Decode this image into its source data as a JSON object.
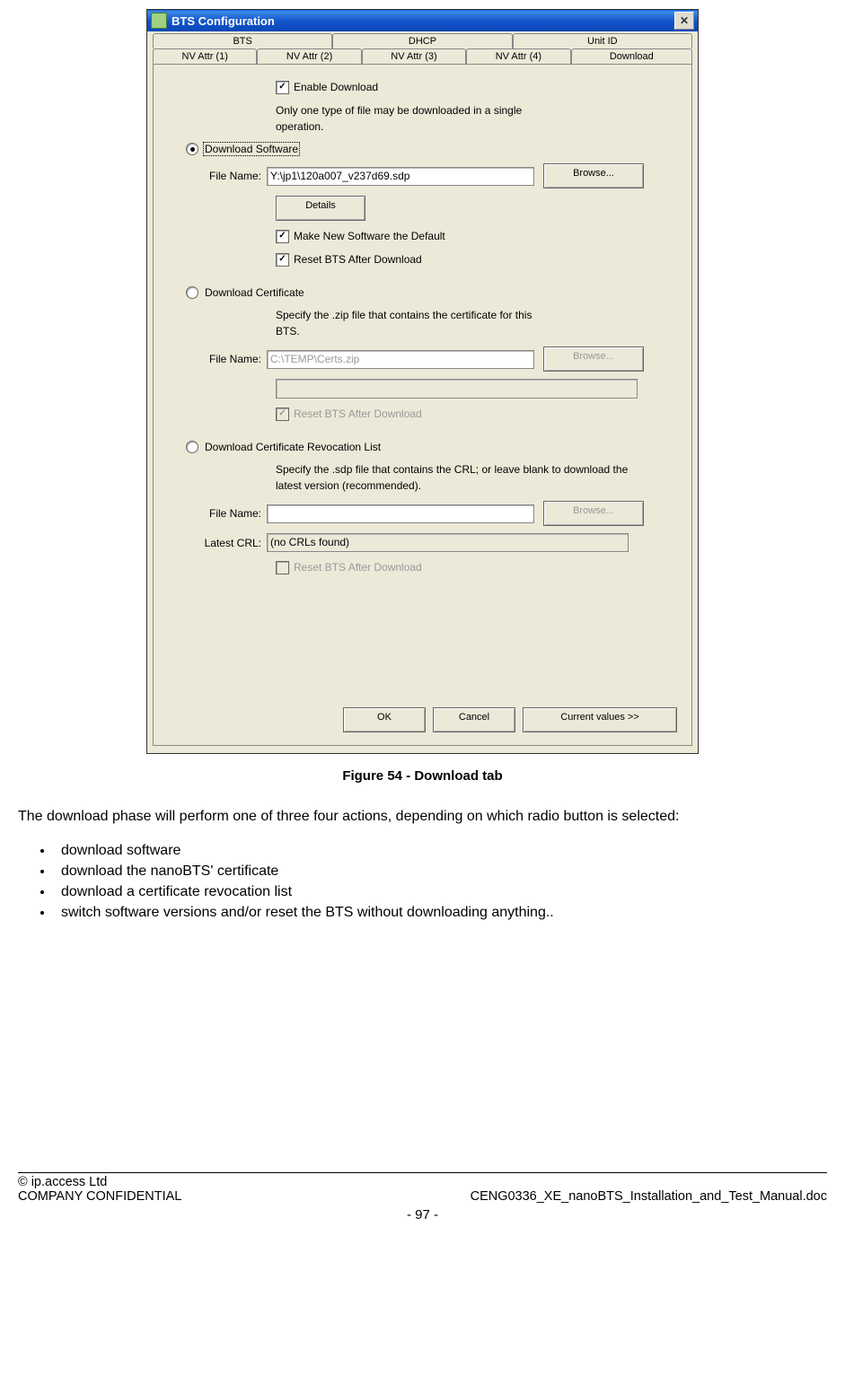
{
  "dialog": {
    "title": "BTS Configuration",
    "tabs_row1": [
      "BTS",
      "DHCP",
      "Unit ID"
    ],
    "tabs_row2": [
      "NV Attr (1)",
      "NV Attr (2)",
      "NV Attr (3)",
      "NV Attr (4)",
      "Download"
    ],
    "enable_download_label": "Enable Download",
    "info_text": "Only one type of file may be downloaded in a single operation.",
    "download_software_label": "Download Software",
    "file_name_label": "File Name:",
    "software_filename": "Y:\\jp1\\120a007_v237d69.sdp",
    "browse_label": "Browse...",
    "details_label": "Details",
    "make_default_label": "Make New Software the Default",
    "reset_after_label": "Reset BTS After Download",
    "download_cert_label": "Download Certificate",
    "cert_info": "Specify the .zip file that contains the certificate for this BTS.",
    "cert_filename": "C:\\TEMP\\Certs.zip",
    "download_crl_label": "Download Certificate Revocation List",
    "crl_info": "Specify the .sdp file that contains the CRL; or leave blank to download the latest version (recommended).",
    "crl_filename": "",
    "latest_crl_label": "Latest CRL:",
    "latest_crl_value": "(no CRLs found)",
    "ok_label": "OK",
    "cancel_label": "Cancel",
    "current_values_label": "Current values >>"
  },
  "doc": {
    "figure_caption": "Figure 54 - Download tab",
    "para1": "The download phase will perform one of three four actions, depending on which radio button is selected:",
    "bullets": [
      "download software",
      "download the nanoBTS' certificate",
      "download a certificate revocation list",
      "switch software versions and/or reset the BTS without downloading anything.."
    ],
    "copyright": "© ip.access Ltd",
    "confidential": "COMPANY CONFIDENTIAL",
    "docname": "CENG0336_XE_nanoBTS_Installation_and_Test_Manual.doc",
    "page": "- 97 -"
  }
}
